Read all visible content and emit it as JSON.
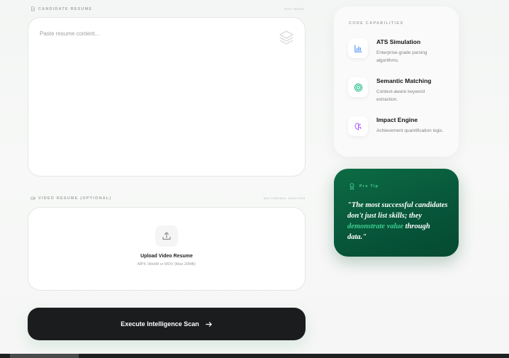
{
  "resume": {
    "label": "Candidate Resume",
    "meta": "Text Mode",
    "placeholder": "Paste resume content..."
  },
  "video": {
    "label": "Video Resume (Optional)",
    "meta": "Multimodal Analysis",
    "upload_title": "Upload Video Resume",
    "upload_subtitle": "MP4, WebM or MOV (Max 20MB)"
  },
  "execute_button": {
    "label": "Execute Intelligence Scan"
  },
  "capabilities": {
    "heading": "Core Capabilities",
    "items": [
      {
        "title": "ATS Simulation",
        "description": "Enterprise-grade parsing algorithms.",
        "icon": "bar-chart-icon"
      },
      {
        "title": "Semantic Matching",
        "description": "Context-aware keyword extraction.",
        "icon": "target-icon"
      },
      {
        "title": "Impact Engine",
        "description": "Achievement quantification logic.",
        "icon": "brain-icon"
      }
    ]
  },
  "pro_tip": {
    "label": "Pro Tip",
    "quote_start": "\"The most successful candidates don't just list skills; they ",
    "quote_highlight": "demonstrate value",
    "quote_end": " through data.\""
  },
  "colors": {
    "accent_green": "#3ecf8e",
    "tip_bg": "#07553a",
    "button_bg": "#1b1c1d",
    "blue_icon": "#3b82f6",
    "green_icon": "#10b981",
    "purple_icon": "#a855f7"
  }
}
